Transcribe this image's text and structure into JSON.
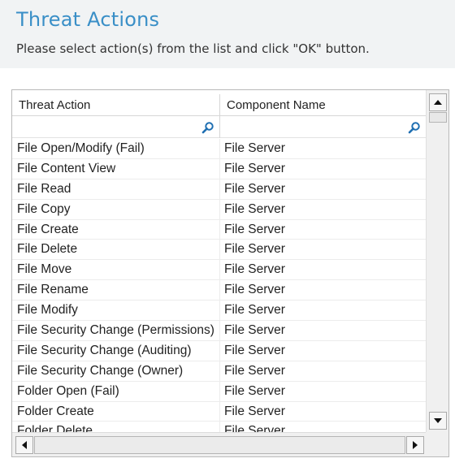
{
  "header": {
    "title": "Threat Actions",
    "subtitle": "Please select action(s) from the list and click \"OK\" button."
  },
  "grid": {
    "columns": [
      "Threat Action",
      "Component Name"
    ],
    "filters": {
      "threat_action": "",
      "component_name": ""
    },
    "rows": [
      [
        "File Open/Modify (Fail)",
        "File Server"
      ],
      [
        "File Content View",
        "File Server"
      ],
      [
        "File Read",
        "File Server"
      ],
      [
        "File Copy",
        "File Server"
      ],
      [
        "File Create",
        "File Server"
      ],
      [
        "File Delete",
        "File Server"
      ],
      [
        "File Move",
        "File Server"
      ],
      [
        "File Rename",
        "File Server"
      ],
      [
        "File Modify",
        "File Server"
      ],
      [
        "File Security Change (Permissions)",
        "File Server"
      ],
      [
        "File Security Change (Auditing)",
        "File Server"
      ],
      [
        "File Security Change (Owner)",
        "File Server"
      ],
      [
        "Folder Open (Fail)",
        "File Server"
      ],
      [
        "Folder Create",
        "File Server"
      ],
      [
        "Folder Delete",
        "File Server"
      ]
    ]
  },
  "colors": {
    "title": "#3a8fc7",
    "header_bg": "#f1f3f4"
  },
  "icons": {
    "filter": "search-icon",
    "scroll": [
      "scroll-up-icon",
      "scroll-down-icon",
      "scroll-left-icon",
      "scroll-right-icon"
    ]
  }
}
